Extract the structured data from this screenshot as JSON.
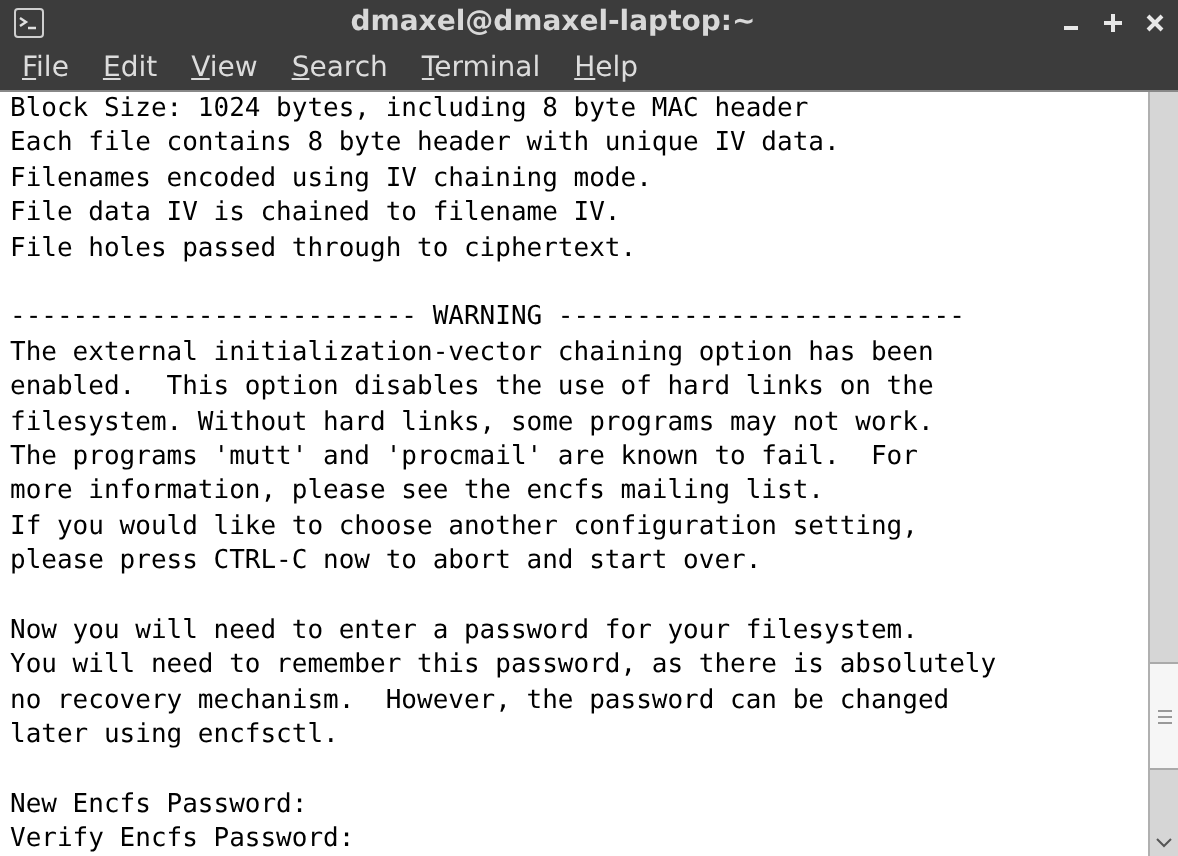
{
  "window": {
    "title": "dmaxel@dmaxel-laptop:~"
  },
  "menu": [
    "File",
    "Edit",
    "View",
    "Search",
    "Terminal",
    "Help"
  ],
  "terminal": {
    "blocks": [
      [
        "Block Size: 1024 bytes, including 8 byte MAC header",
        "Each file contains 8 byte header with unique IV data.",
        "Filenames encoded using IV chaining mode.",
        "File data IV is chained to filename IV.",
        "File holes passed through to ciphertext."
      ],
      [
        "-------------------------- WARNING --------------------------",
        "The external initialization-vector chaining option has been",
        "enabled.  This option disables the use of hard links on the",
        "filesystem. Without hard links, some programs may not work.",
        "The programs 'mutt' and 'procmail' are known to fail.  For",
        "more information, please see the encfs mailing list.",
        "If you would like to choose another configuration setting,",
        "please press CTRL-C now to abort and start over."
      ],
      [
        "Now you will need to enter a password for your filesystem.",
        "You will need to remember this password, as there is absolutely",
        "no recovery mechanism.  However, the password can be changed",
        "later using encfsctl."
      ],
      [
        "New Encfs Password:",
        "Verify Encfs Password:"
      ]
    ]
  }
}
